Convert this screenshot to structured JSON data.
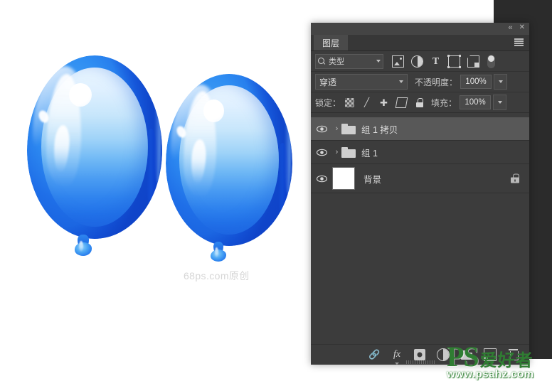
{
  "app": {
    "panel_title": "图层",
    "titlebar": {
      "collapse_label": "«",
      "close_label": "✕"
    },
    "menu_icon": "hamburger-menu-icon"
  },
  "filter_bar": {
    "type_label": "类型",
    "search_icon": "search-icon",
    "icons": [
      {
        "name": "pixel-layer-filter-icon",
        "glyph": ""
      },
      {
        "name": "adjustment-layer-filter-icon",
        "glyph": ""
      },
      {
        "name": "type-layer-filter-icon",
        "glyph": "T"
      },
      {
        "name": "shape-layer-filter-icon",
        "glyph": ""
      },
      {
        "name": "smart-object-filter-icon",
        "glyph": ""
      }
    ],
    "toggle_name": "filter-enable-toggle"
  },
  "blend_bar": {
    "blend_mode": "穿透",
    "opacity_label": "不透明度：",
    "opacity_value": "100%"
  },
  "lock_bar": {
    "lock_label": "锁定：",
    "icons": [
      {
        "name": "lock-transparent-pixels-icon"
      },
      {
        "name": "lock-image-pixels-icon"
      },
      {
        "name": "lock-position-icon"
      },
      {
        "name": "lock-artboard-nesting-icon"
      },
      {
        "name": "lock-all-icon"
      }
    ],
    "fill_label": "填充：",
    "fill_value": "100%"
  },
  "layers": [
    {
      "name": "组 1 拷贝",
      "type": "group",
      "visible": true,
      "selected": true,
      "expanded": false,
      "locked": false
    },
    {
      "name": "组 1",
      "type": "group",
      "visible": true,
      "selected": false,
      "expanded": false,
      "locked": false
    },
    {
      "name": "背景",
      "type": "background",
      "visible": true,
      "selected": false,
      "expanded": false,
      "locked": true
    }
  ],
  "footer_buttons": [
    {
      "name": "link-layers-button",
      "label": "link"
    },
    {
      "name": "add-layer-style-button",
      "label": "fx"
    },
    {
      "name": "add-layer-mask-button",
      "label": "mask"
    },
    {
      "name": "new-fill-adjustment-layer-button",
      "label": "adjustment"
    },
    {
      "name": "new-group-button",
      "label": "group"
    },
    {
      "name": "new-layer-button",
      "label": "new"
    },
    {
      "name": "delete-layer-button",
      "label": "delete"
    }
  ],
  "canvas": {
    "watermark_text": "68ps.com原创",
    "balloons": [
      {
        "id": "balloon-left",
        "color_shell": "#2f8ef2",
        "color_face_top": "#eaf6ff",
        "color_face_bottom": "#1e67e4"
      },
      {
        "id": "balloon-right",
        "color_shell": "#2f8ef2",
        "color_face_top": "#eaf6ff",
        "color_face_bottom": "#1e67e4"
      }
    ]
  },
  "site_watermark": {
    "brand": "PS",
    "brand_cn": "爱好者",
    "url": "www.psahz.com",
    "color": "#2f7d32"
  }
}
